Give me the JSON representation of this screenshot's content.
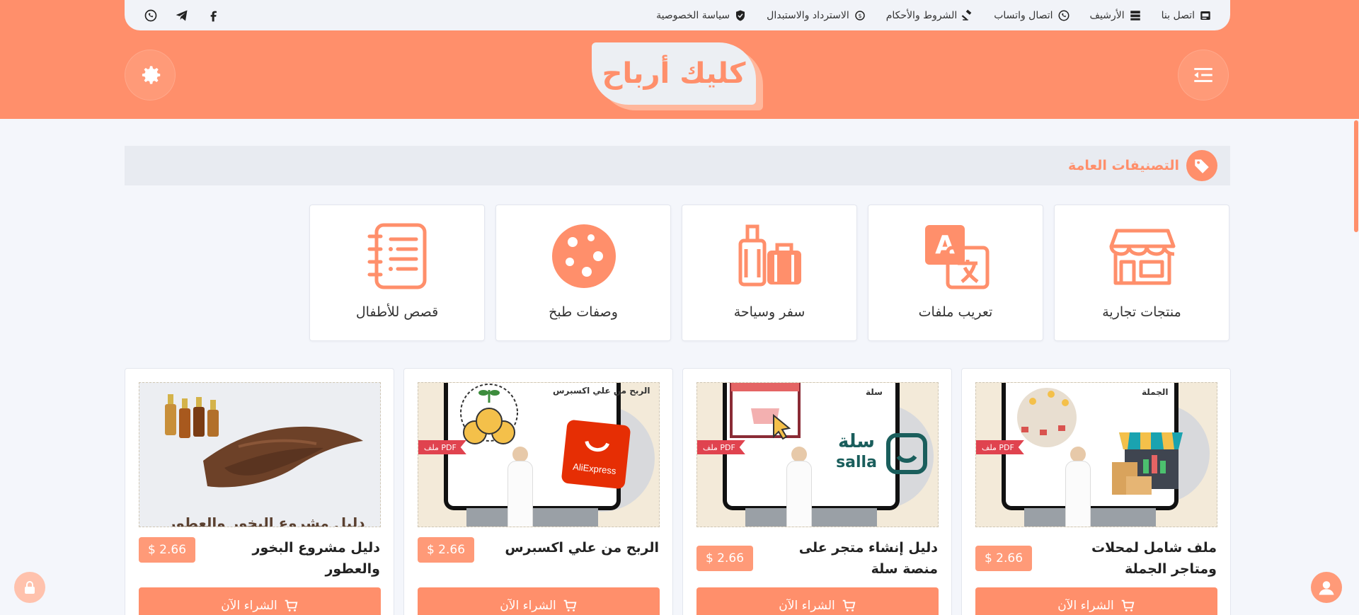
{
  "site": {
    "logo_text": "كليك أرباح",
    "accent_color": "#ff8f6b"
  },
  "topbar": {
    "links": [
      {
        "label": "اتصل بنا",
        "icon": "contact-card-icon"
      },
      {
        "label": "الأرشيف",
        "icon": "archive-icon"
      },
      {
        "label": "اتصال واتساب",
        "icon": "whatsapp-icon"
      },
      {
        "label": "الشروط والأحكام",
        "icon": "gavel-icon"
      },
      {
        "label": "الاسترداد والاستبدال",
        "icon": "refund-icon"
      },
      {
        "label": "سياسة الخصوصية",
        "icon": "shield-icon"
      }
    ],
    "socials": [
      "facebook-icon",
      "telegram-icon",
      "whatsapp-icon"
    ]
  },
  "section": {
    "title": "التصنيفات العامة"
  },
  "categories": [
    {
      "label": "منتجات تجارية",
      "icon": "store-icon"
    },
    {
      "label": "تعريب ملفات",
      "icon": "translate-icon"
    },
    {
      "label": "سفر وسياحة",
      "icon": "luggage-icon"
    },
    {
      "label": "وصفات طبخ",
      "icon": "cookie-icon"
    },
    {
      "label": "قصص للأطفال",
      "icon": "notebook-icon"
    }
  ],
  "products": [
    {
      "title": "ملف شامل لمحلات ومتاجر الجملة",
      "price": "$ 2.66",
      "badge": "ملف PDF",
      "caption": "الجملة",
      "buy_label": "الشراء الآن"
    },
    {
      "title": "دليل إنشاء متجر على منصة سلة",
      "price": "$ 2.66",
      "badge": "ملف PDF",
      "caption": "سلة",
      "buy_label": "الشراء الآن"
    },
    {
      "title": "الربح من علي اكسبرس",
      "price": "$ 2.66",
      "badge": "ملف PDF",
      "caption": "الربح من علي اكسبرس",
      "buy_label": "الشراء الآن"
    },
    {
      "title": "دليل مشروع البخور والعطور",
      "price": "$ 2.66",
      "caption": "دليل مشروع البخور والعطور",
      "buy_label": "الشراء الآن"
    }
  ],
  "image_labels": {
    "salla_logo": "سلة",
    "salla_latin": "salla",
    "aliexpress_logo": "AliExpress"
  }
}
